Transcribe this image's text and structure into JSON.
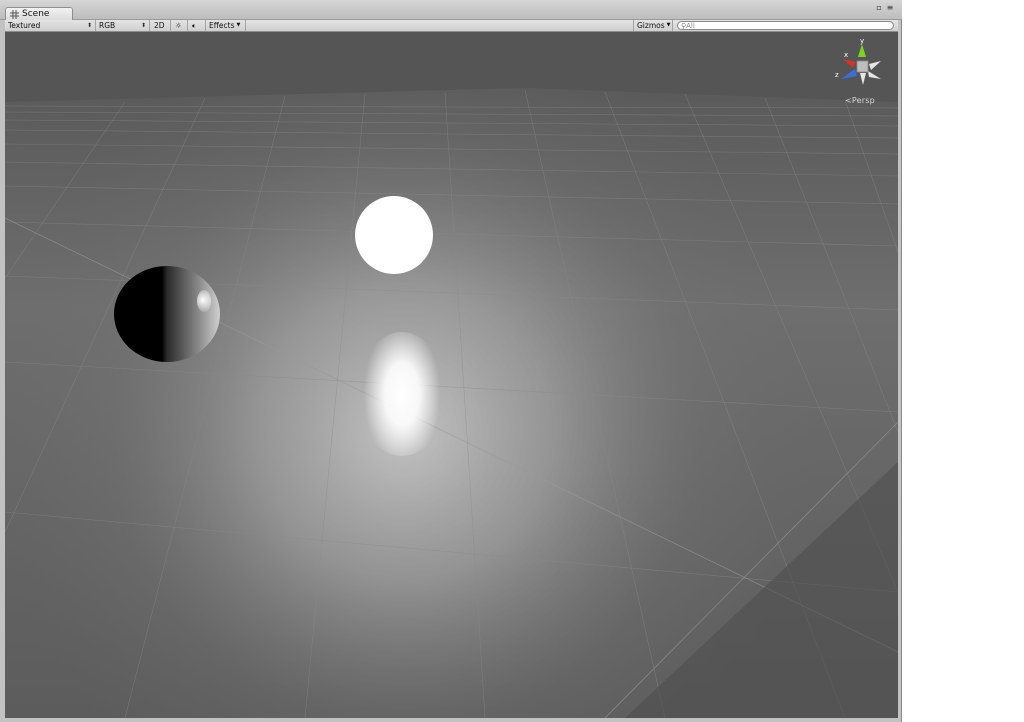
{
  "window": {
    "tab_title": "Scene"
  },
  "toolbar": {
    "draw_mode": "Textured",
    "render_mode": "RGB",
    "toggle_2d": "2D",
    "effects_label": "Effects",
    "gizmos_label": "Gizmos",
    "search_placeholder": "All"
  },
  "gizmo": {
    "axis_y": "y",
    "axis_x": "x",
    "axis_z": "z",
    "projection_label": "Persp"
  },
  "colors": {
    "axis_y": "#7ed321",
    "axis_x": "#d0342c",
    "axis_z": "#3a6fd8",
    "sky": "#555555",
    "ground": "#6a6a6a"
  }
}
